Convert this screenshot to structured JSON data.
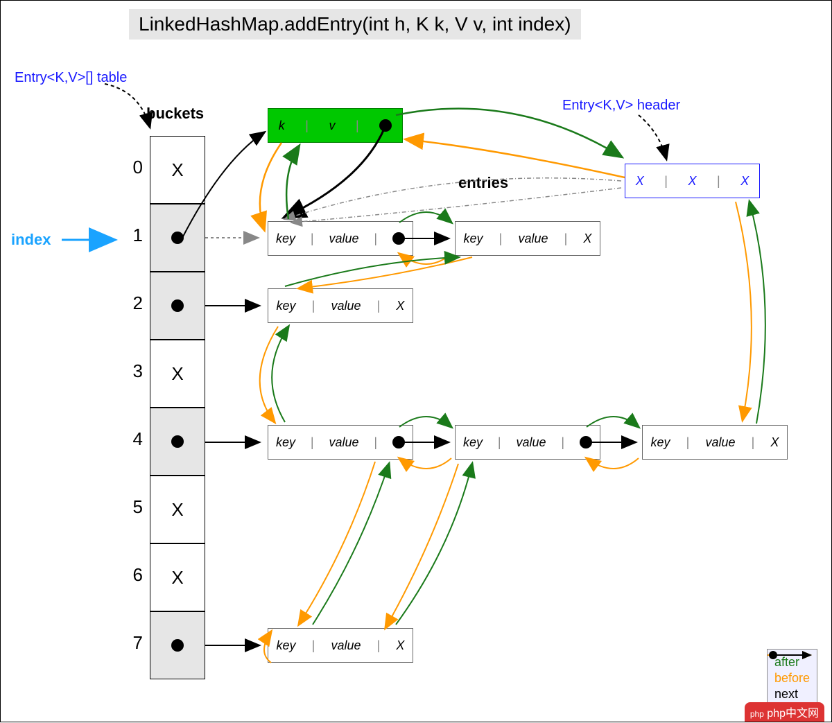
{
  "title": "LinkedHashMap.addEntry(int h, K k, V v, int index)",
  "labels": {
    "table": "Entry<K,V>[] table",
    "buckets": "buckets",
    "header": "Entry<K,V> header",
    "entries": "entries",
    "index": "index"
  },
  "buckets": [
    {
      "i": "0",
      "content": "X",
      "shade": false,
      "dot": false
    },
    {
      "i": "1",
      "content": "",
      "shade": true,
      "dot": true
    },
    {
      "i": "2",
      "content": "",
      "shade": true,
      "dot": true
    },
    {
      "i": "3",
      "content": "X",
      "shade": false,
      "dot": false
    },
    {
      "i": "4",
      "content": "",
      "shade": true,
      "dot": true
    },
    {
      "i": "5",
      "content": "X",
      "shade": false,
      "dot": false
    },
    {
      "i": "6",
      "content": "X",
      "shade": false,
      "dot": false
    },
    {
      "i": "7",
      "content": "",
      "shade": true,
      "dot": true
    }
  ],
  "newEntry": {
    "k": "k",
    "v": "v"
  },
  "headerEntry": {
    "a": "X",
    "b": "X",
    "c": "X"
  },
  "node": {
    "key": "key",
    "value": "value",
    "null": "X"
  },
  "legend": {
    "after": "after",
    "before": "before",
    "next": "next"
  },
  "watermark": "php中文网",
  "colors": {
    "after": "#1a7a1a",
    "before": "#ff9900",
    "next": "#000",
    "dashed": "#000",
    "faded": "#888",
    "blue": "#1aa3ff"
  }
}
